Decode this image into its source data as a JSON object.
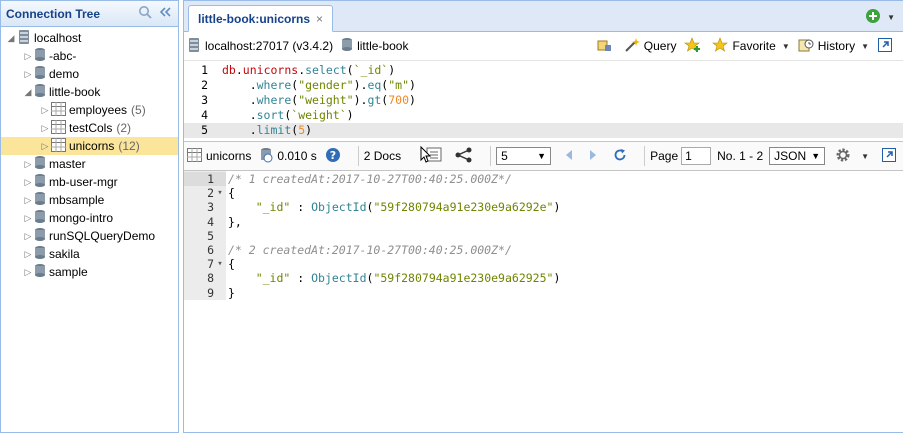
{
  "sidebar": {
    "title": "Connection Tree",
    "tree": [
      {
        "label": "localhost",
        "level": 0,
        "expand": "down",
        "icon": "server-icon",
        "name": "tree-node-localhost"
      },
      {
        "label": "-abc-",
        "level": 1,
        "expand": "right",
        "icon": "database-icon",
        "name": "tree-node-abc"
      },
      {
        "label": "demo",
        "level": 1,
        "expand": "right",
        "icon": "database-icon",
        "name": "tree-node-demo"
      },
      {
        "label": "little-book",
        "level": 1,
        "expand": "down",
        "icon": "database-icon",
        "name": "tree-node-little-book"
      },
      {
        "label": "employees",
        "count": "(5)",
        "level": 2,
        "expand": "right",
        "icon": "collection-icon",
        "name": "tree-node-employees"
      },
      {
        "label": "testCols",
        "count": "(2)",
        "level": 2,
        "expand": "right",
        "icon": "collection-icon",
        "name": "tree-node-testcols"
      },
      {
        "label": "unicorns",
        "count": "(12)",
        "level": 2,
        "expand": "right",
        "icon": "collection-icon",
        "selected": true,
        "name": "tree-node-unicorns"
      },
      {
        "label": "master",
        "level": 1,
        "expand": "right",
        "icon": "database-icon",
        "name": "tree-node-master"
      },
      {
        "label": "mb-user-mgr",
        "level": 1,
        "expand": "right",
        "icon": "database-icon",
        "name": "tree-node-mb-user-mgr"
      },
      {
        "label": "mbsample",
        "level": 1,
        "expand": "right",
        "icon": "database-icon",
        "name": "tree-node-mbsample"
      },
      {
        "label": "mongo-intro",
        "level": 1,
        "expand": "right",
        "icon": "database-icon",
        "name": "tree-node-mongo-intro"
      },
      {
        "label": "runSQLQueryDemo",
        "level": 1,
        "expand": "right",
        "icon": "database-icon",
        "name": "tree-node-runsqlquerydemo"
      },
      {
        "label": "sakila",
        "level": 1,
        "expand": "right",
        "icon": "database-icon",
        "name": "tree-node-sakila"
      },
      {
        "label": "sample",
        "level": 1,
        "expand": "right",
        "icon": "database-icon",
        "name": "tree-node-sample"
      }
    ]
  },
  "tab": {
    "label": "little-book:unicorns",
    "close": "×"
  },
  "toolbar": {
    "server": "localhost:27017 (v3.4.2)",
    "database": "little-book",
    "query": "Query",
    "favorite": "Favorite",
    "history": "History"
  },
  "query_lines": [
    [
      [
        "k-var",
        "db"
      ],
      [
        "k-plain",
        "."
      ],
      [
        "k-var",
        "unicorns"
      ],
      [
        "k-plain",
        "."
      ],
      [
        "k-fn",
        "select"
      ],
      [
        "k-plain",
        "("
      ],
      [
        "k-str",
        "`_id`"
      ],
      [
        "k-plain",
        ")"
      ]
    ],
    [
      [
        "k-plain",
        "    ."
      ],
      [
        "k-fn",
        "where"
      ],
      [
        "k-plain",
        "("
      ],
      [
        "k-str",
        "\"gender\""
      ],
      [
        "k-plain",
        ")."
      ],
      [
        "k-fn",
        "eq"
      ],
      [
        "k-plain",
        "("
      ],
      [
        "k-str",
        "\"m\""
      ],
      [
        "k-plain",
        ")"
      ]
    ],
    [
      [
        "k-plain",
        "    ."
      ],
      [
        "k-fn",
        "where"
      ],
      [
        "k-plain",
        "("
      ],
      [
        "k-str",
        "\"weight\""
      ],
      [
        "k-plain",
        ")."
      ],
      [
        "k-fn",
        "gt"
      ],
      [
        "k-plain",
        "("
      ],
      [
        "k-num",
        "700"
      ],
      [
        "k-plain",
        ")"
      ]
    ],
    [
      [
        "k-plain",
        "    ."
      ],
      [
        "k-fn",
        "sort"
      ],
      [
        "k-plain",
        "("
      ],
      [
        "k-str",
        "`weight`"
      ],
      [
        "k-plain",
        ")"
      ]
    ],
    [
      [
        "k-plain",
        "    ."
      ],
      [
        "k-fn",
        "limit"
      ],
      [
        "k-plain",
        "("
      ],
      [
        "k-num",
        "5"
      ],
      [
        "k-plain",
        ")"
      ]
    ]
  ],
  "result_toolbar": {
    "collection": "unicorns",
    "time": "0.010 s",
    "docs": "2 Docs",
    "page_size": "5",
    "page_label": "Page",
    "page_value": "1",
    "range": "No. 1 - 2",
    "format": "JSON"
  },
  "result_lines": [
    {
      "fold": "",
      "parts": [
        [
          "k-cmt",
          "/* 1 createdAt:2017-10-27T00:40:25.000Z*/"
        ]
      ]
    },
    {
      "fold": "▾",
      "parts": [
        [
          "k-plain",
          "{"
        ]
      ]
    },
    {
      "fold": "",
      "parts": [
        [
          "k-plain",
          "    "
        ],
        [
          "k-str",
          "\"_id\""
        ],
        [
          "k-plain",
          " : "
        ],
        [
          "k-fn",
          "ObjectId"
        ],
        [
          "k-plain",
          "("
        ],
        [
          "k-str",
          "\"59f280794a91e230e9a6292e\""
        ],
        [
          "k-plain",
          ")"
        ]
      ]
    },
    {
      "fold": "",
      "parts": [
        [
          "k-plain",
          "},"
        ]
      ]
    },
    {
      "fold": "",
      "parts": [
        [
          "k-plain",
          ""
        ]
      ]
    },
    {
      "fold": "",
      "parts": [
        [
          "k-cmt",
          "/* 2 createdAt:2017-10-27T00:40:25.000Z*/"
        ]
      ]
    },
    {
      "fold": "▾",
      "parts": [
        [
          "k-plain",
          "{"
        ]
      ]
    },
    {
      "fold": "",
      "parts": [
        [
          "k-plain",
          "    "
        ],
        [
          "k-str",
          "\"_id\""
        ],
        [
          "k-plain",
          " : "
        ],
        [
          "k-fn",
          "ObjectId"
        ],
        [
          "k-plain",
          "("
        ],
        [
          "k-str",
          "\"59f280794a91e230e9a62925\""
        ],
        [
          "k-plain",
          ")"
        ]
      ]
    },
    {
      "fold": "",
      "parts": [
        [
          "k-plain",
          "}"
        ]
      ]
    }
  ],
  "colors": {
    "accent": "#15428b",
    "selected": "#fbe59b",
    "border": "#99bbe8"
  }
}
